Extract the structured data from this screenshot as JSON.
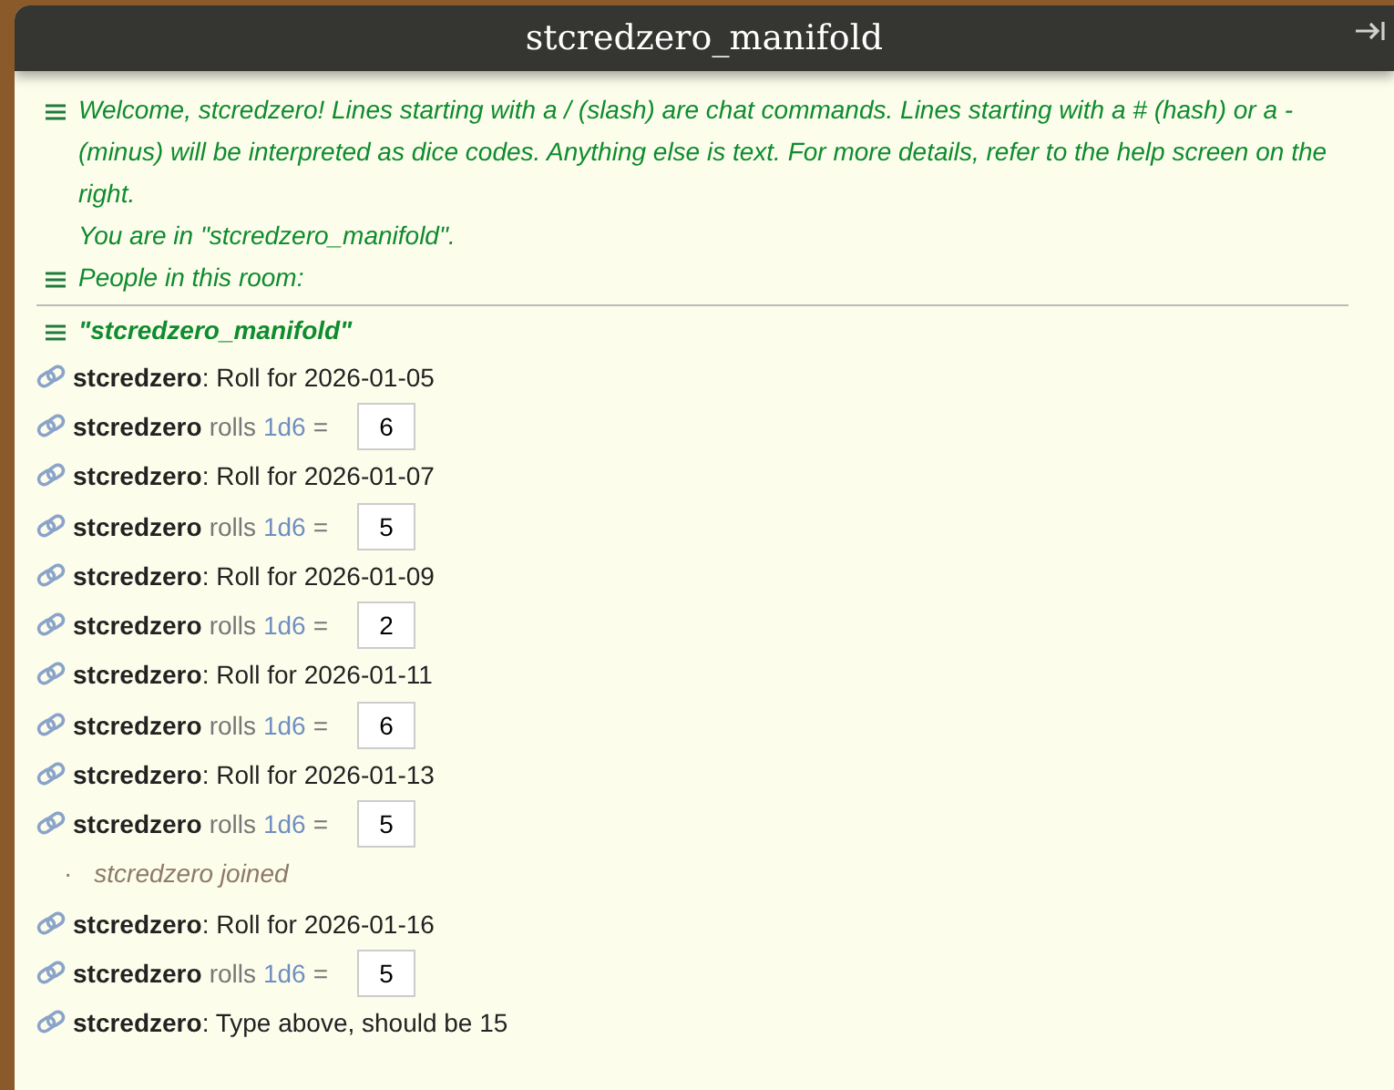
{
  "window": {
    "title": "stcredzero_manifold"
  },
  "messages": [
    {
      "kind": "system",
      "lines": [
        "Welcome, stcredzero! Lines starting with a / (slash) are chat commands. Lines starting with a # (hash) or a - (minus) will be interpreted as dice codes. Anything else is text. For more details, refer to the help screen on the right.",
        "You are in \"stcredzero_manifold\"."
      ]
    },
    {
      "kind": "system",
      "lines": [
        "People in this room:"
      ]
    },
    {
      "kind": "room",
      "lines": [
        "\"stcredzero_manifold\""
      ]
    },
    {
      "kind": "chat",
      "user": "stcredzero",
      "text": ": Roll for 2026-01-05"
    },
    {
      "kind": "roll",
      "user": "stcredzero",
      "verb": "rolls",
      "dice": "1d6",
      "eq": "=",
      "result": "6"
    },
    {
      "kind": "chat",
      "user": "stcredzero",
      "text": ": Roll for 2026-01-07"
    },
    {
      "kind": "roll",
      "user": "stcredzero",
      "verb": "rolls",
      "dice": "1d6",
      "eq": "=",
      "result": "5"
    },
    {
      "kind": "chat",
      "user": "stcredzero",
      "text": ": Roll for 2026-01-09"
    },
    {
      "kind": "roll",
      "user": "stcredzero",
      "verb": "rolls",
      "dice": "1d6",
      "eq": "=",
      "result": "2"
    },
    {
      "kind": "chat",
      "user": "stcredzero",
      "text": ": Roll for 2026-01-11"
    },
    {
      "kind": "roll",
      "user": "stcredzero",
      "verb": "rolls",
      "dice": "1d6",
      "eq": "=",
      "result": "6"
    },
    {
      "kind": "chat",
      "user": "stcredzero",
      "text": ": Roll for 2026-01-13"
    },
    {
      "kind": "roll",
      "user": "stcredzero",
      "verb": "rolls",
      "dice": "1d6",
      "eq": "=",
      "result": "5"
    },
    {
      "kind": "join",
      "dot": "·",
      "text": "stcredzero joined"
    },
    {
      "kind": "chat",
      "user": "stcredzero",
      "text": ": Roll for 2026-01-16"
    },
    {
      "kind": "roll",
      "user": "stcredzero",
      "verb": "rolls",
      "dice": "1d6",
      "eq": "=",
      "result": "5"
    },
    {
      "kind": "chat",
      "user": "stcredzero",
      "text": ": Type above, should be 15"
    }
  ]
}
